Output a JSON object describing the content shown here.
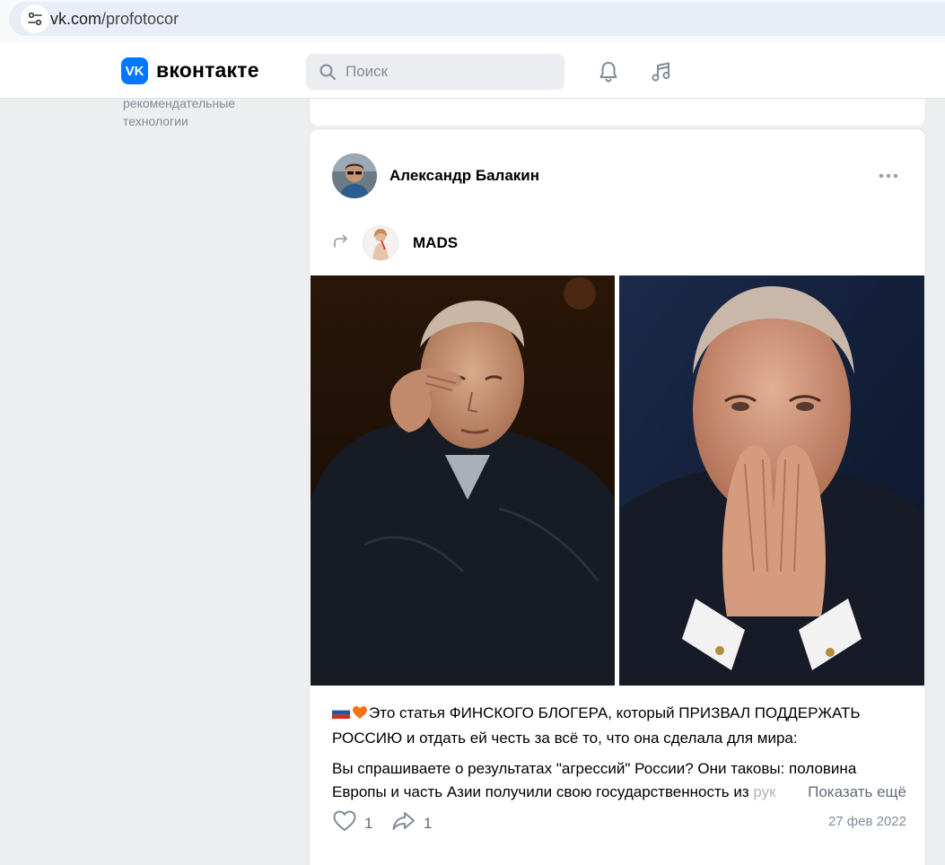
{
  "browser": {
    "url_domain": "vk.com",
    "url_path": "/profotocor"
  },
  "header": {
    "logo_text": "VK",
    "brand": "вконтакте",
    "search_placeholder": "Поиск"
  },
  "left_menu": {
    "line1": "рекомендательные",
    "line2": "технологии"
  },
  "post": {
    "author": "Александр Балакин",
    "repost_source": "MADS",
    "paragraph1": "Это статья ФИНСКОГО БЛОГЕРА, который ПРИЗВАЛ ПОДДЕРЖАТЬ РОССИЮ и отдать ей честь за всё то, что она сделала для мира:",
    "paragraph2_line1": "Вы спрашиваете о результатах \"агрессий\" России? Они таковы: половина",
    "paragraph2_line2": "Европы и часть Азии получили свою государственность из ",
    "paragraph2_fade": "рук",
    "show_more": "Показать ещё",
    "likes": "1",
    "shares": "1",
    "date": "27 фев 2022"
  },
  "colors": {
    "accent": "#0077ff",
    "background": "#edeef0",
    "secondary_text": "#818c99"
  },
  "icons": [
    "site-info-icon",
    "vk-logo-icon",
    "search-icon",
    "bell-icon",
    "music-note-icon",
    "more-dots-icon",
    "repost-arrow-icon",
    "heart-icon",
    "share-arrow-icon"
  ]
}
